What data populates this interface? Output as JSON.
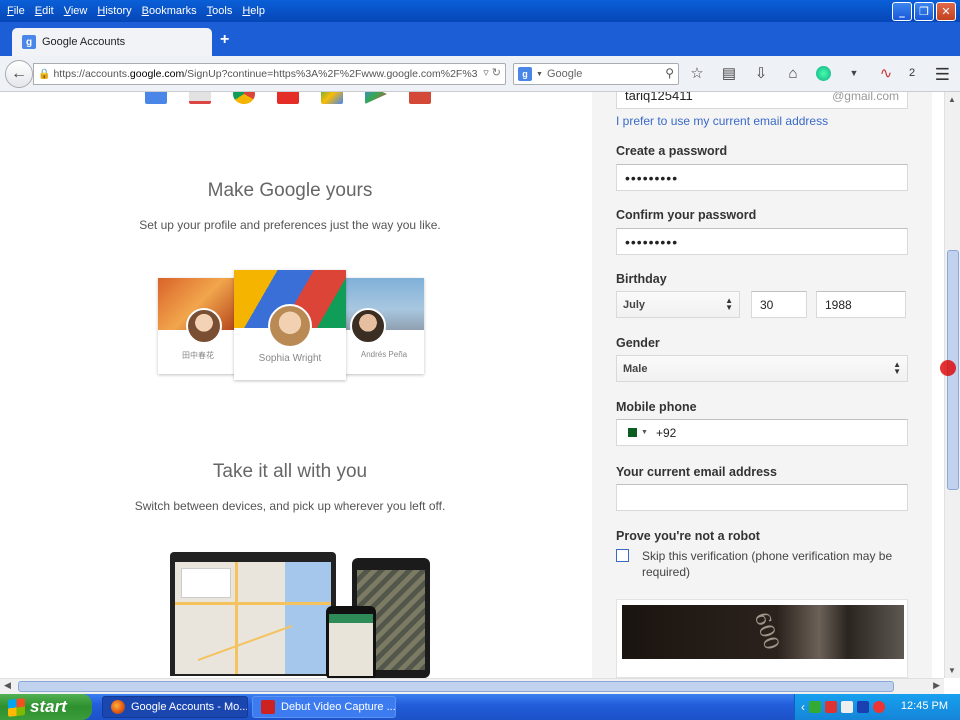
{
  "menu": [
    "File",
    "Edit",
    "View",
    "History",
    "Bookmarks",
    "Tools",
    "Help"
  ],
  "window_buttons": {
    "minimize": "_",
    "maximize": "❐",
    "close": "✕"
  },
  "tab": {
    "title": "Google Accounts",
    "new_tab": "+"
  },
  "nav": {
    "url_pre": "https://accounts.",
    "url_domain": "google.com",
    "url_post": "/SignUp?continue=https%3A%2F%2Fwww.google.com%2F%3",
    "search_placeholder": "Google",
    "addon_count": "2"
  },
  "left": {
    "section1_title": "Make Google yours",
    "section1_sub": "Set up your profile and preferences just the way you like.",
    "profiles": {
      "left": "田中春花",
      "center": "Sophia Wright",
      "right": "Andrés Peña"
    },
    "section2_title": "Take it all with you",
    "section2_sub": "Switch between devices, and pick up wherever you left off."
  },
  "form": {
    "username_value": "tariq125411",
    "username_suffix": "@gmail.com",
    "prefer_link": "I prefer to use my current email address",
    "password_label": "Create a password",
    "password_value": "•••••••••",
    "confirm_label": "Confirm your password",
    "confirm_value": "•••••••••",
    "birthday_label": "Birthday",
    "birthday_month": "July",
    "birthday_day": "30",
    "birthday_year": "1988",
    "gender_label": "Gender",
    "gender_value": "Male",
    "phone_label": "Mobile phone",
    "phone_code": "+92",
    "email_label": "Your current email address",
    "email_value": "",
    "robot_label": "Prove you're not a robot",
    "skip_text": "Skip this verification (phone verification may be required)",
    "captcha_text": "600"
  },
  "taskbar": {
    "start": "start",
    "items": [
      "Google Accounts - Mo...",
      "Debut Video Capture ..."
    ],
    "clock": "12:45 PM"
  },
  "colors": {
    "title_blue": "#0a5fd8",
    "link_blue": "#3a69c8",
    "taskbar_blue": "#245edb",
    "start_green": "#3b9c3b"
  }
}
